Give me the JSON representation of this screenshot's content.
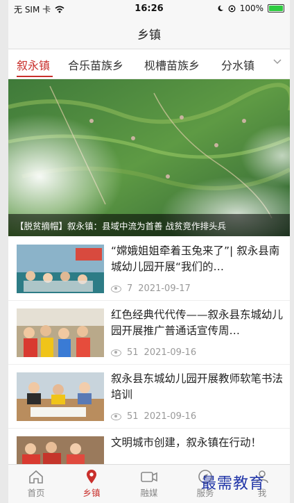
{
  "status": {
    "carrier": "无 SIM 卡",
    "time": "16:26",
    "battery": "100%"
  },
  "nav": {
    "title": "乡镇"
  },
  "tabs": [
    {
      "label": "叙永镇",
      "active": true
    },
    {
      "label": "合乐苗族乡",
      "active": false
    },
    {
      "label": "枧槽苗族乡",
      "active": false
    },
    {
      "label": "分水镇",
      "active": false
    }
  ],
  "hero": {
    "caption": "【脱贫摘帽】叙永镇：县域中流为首善 战贫竞作排头兵"
  },
  "articles": [
    {
      "title": "“嫦娥姐姐牵着玉兔来了”| 叙永县南城幼儿园开展“我们的…",
      "views": "7",
      "date": "2021-09-17"
    },
    {
      "title": "红色经典代代传——叙永县东城幼儿园开展推广普通话宣传周…",
      "views": "51",
      "date": "2021-09-16"
    },
    {
      "title": "叙永县东城幼儿园开展教师软笔书法培训",
      "views": "51",
      "date": "2021-09-16"
    },
    {
      "title": "文明城市创建，叙永镇在行动！",
      "views": "",
      "date": ""
    }
  ],
  "tabbar": [
    {
      "label": "首页",
      "icon": "home-icon"
    },
    {
      "label": "乡镇",
      "icon": "location-pin-icon"
    },
    {
      "label": "融媒",
      "icon": "video-camera-icon"
    },
    {
      "label": "服务",
      "icon": "compass-icon"
    },
    {
      "label": "我",
      "icon": "user-icon"
    }
  ],
  "watermark": "最需教育",
  "colors": {
    "accent": "#c9302c"
  }
}
